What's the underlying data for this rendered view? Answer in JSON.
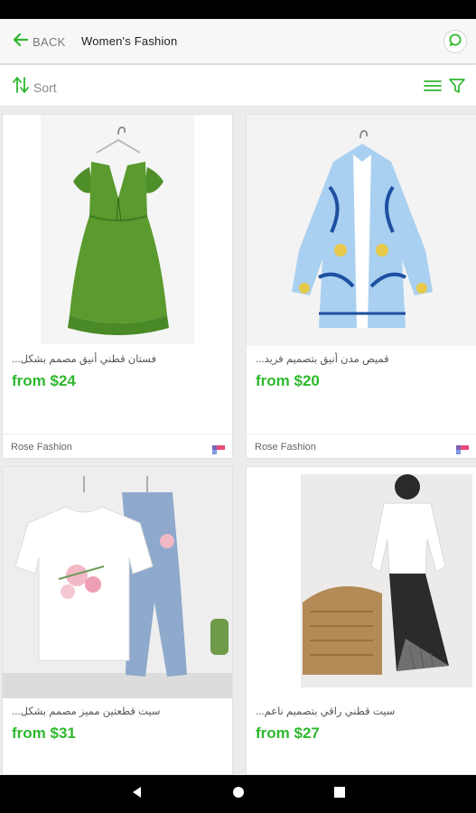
{
  "header": {
    "back_label": "BACK",
    "title": "Women's Fashion"
  },
  "toolbar": {
    "sort_label": "Sort"
  },
  "colors": {
    "accent": "#2eb82e",
    "price": "#2eb82e",
    "status_bar": "#000000"
  },
  "products": [
    {
      "name": "فستان قطني أنيق مصمم بشكل...",
      "price": "from $24",
      "seller": "Rose Fashion"
    },
    {
      "name": "قميص مدن أنيق بتصميم فريد...",
      "price": "from $20",
      "seller": "Rose Fashion"
    },
    {
      "name": "سيت قطعتين مميز مصمم بشكل...",
      "price": "from $31",
      "seller": ""
    },
    {
      "name": "سيت قطني راقي بتصميم ناعم...",
      "price": "from $27",
      "seller": ""
    }
  ],
  "icons": {
    "back": "arrow-left-icon",
    "chat": "chat-bubble-icon",
    "sort": "sort-arrows-icon",
    "list": "list-view-icon",
    "filter": "filter-funnel-icon"
  }
}
